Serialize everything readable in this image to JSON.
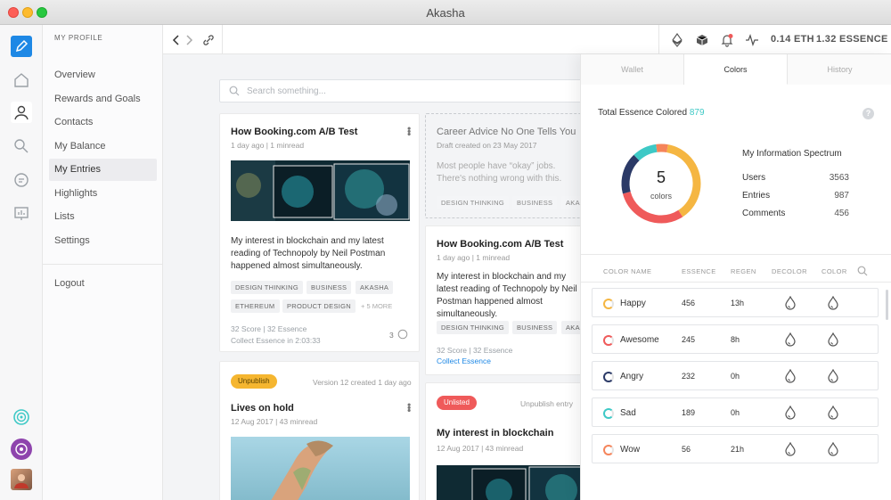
{
  "window": {
    "title": "Akasha"
  },
  "rail": {
    "icons": [
      "pencil-icon",
      "home-icon",
      "user-icon",
      "search-icon",
      "chat-icon",
      "chart-icon",
      "spiral-icon",
      "swirl-icon",
      "avatar"
    ]
  },
  "sidebar": {
    "heading": "MY PROFILE",
    "items": [
      {
        "label": "Overview"
      },
      {
        "label": "Rewards and Goals"
      },
      {
        "label": "Contacts"
      },
      {
        "label": "My Balance"
      },
      {
        "label": "My Entries",
        "active": true
      },
      {
        "label": "Highlights"
      },
      {
        "label": "Lists"
      },
      {
        "label": "Settings"
      }
    ],
    "logout": "Logout"
  },
  "toolbar": {
    "eth": "0.14 ETH",
    "essence": "1.32 ESSENCE"
  },
  "search": {
    "placeholder": "Search something..."
  },
  "cards": {
    "c1": {
      "title": "How Booking.com A/B Test",
      "meta": "1 day ago  |  1 minread",
      "body": "My interest in blockchain and my latest reading of Technopoly by Neil Postman happened almost simultaneously.",
      "tags": [
        "DESIGN THINKING",
        "BUSINESS",
        "AKASHA",
        "ETHEREUM",
        "PRODUCT DESIGN"
      ],
      "more": "+ 5 MORE",
      "score": "32 Score | 32 Essence",
      "collect": "Collect Essence in 2:03:33",
      "comments": "3"
    },
    "c2": {
      "title": "Career Advice No One Tells You",
      "meta": "Draft created on 23 May 2017",
      "body": "Most people have “okay” jobs. There's nothing wrong with this.",
      "tags": [
        "DESIGN THINKING",
        "BUSINESS",
        "AKA"
      ]
    },
    "c3": {
      "title": "How Booking.com A/B Test",
      "meta": "1 day ago  |  1 minread",
      "body": "My interest in blockchain and my latest reading of Technopoly by Neil Postman happened almost simultaneously.",
      "tags": [
        "DESIGN THINKING",
        "BUSINESS",
        "AKA"
      ],
      "score": "32 Score | 32 Essence",
      "collect": "Collect Essence"
    },
    "c4": {
      "badge": "Unpublish",
      "version": "Version 12 created 1 day ago",
      "title": "Lives on hold",
      "meta": "12 Aug 2017  |  43 minread"
    },
    "c5": {
      "badge": "Unlisted",
      "status": "Unpublish  entry",
      "title": "My interest in blockchain",
      "meta": "12 Aug 2017  |  43 minread"
    }
  },
  "panel": {
    "tabs": [
      "Wallet",
      "Colors",
      "History"
    ],
    "total_label": "Total Essence Colored",
    "total_value": "879",
    "help": "?",
    "donut": {
      "number": "5",
      "label": "colors"
    },
    "spectrum": {
      "title": "My Information Spectrum",
      "rows": [
        {
          "label": "Users",
          "value": "3563"
        },
        {
          "label": "Entries",
          "value": "987"
        },
        {
          "label": "Comments",
          "value": "456"
        }
      ]
    },
    "columns": [
      "COLOR NAME",
      "ESSENCE",
      "REGEN",
      "DECOLOR",
      "COLOR"
    ],
    "colors": [
      {
        "name": "Happy",
        "essence": "456",
        "regen": "13h",
        "color": "#f5b642"
      },
      {
        "name": "Awesome",
        "essence": "245",
        "regen": "8h",
        "color": "#ef5a5a"
      },
      {
        "name": "Angry",
        "essence": "232",
        "regen": "0h",
        "color": "#2b3a67"
      },
      {
        "name": "Sad",
        "essence": "189",
        "regen": "0h",
        "color": "#3ec9c6"
      },
      {
        "name": "Wow",
        "essence": "56",
        "regen": "21h",
        "color": "#f5845a"
      }
    ]
  },
  "accent": {
    "blue": "#1e88e5",
    "teal": "#3ec9c6",
    "yellow": "#f5b642",
    "red": "#ef5a5a"
  }
}
